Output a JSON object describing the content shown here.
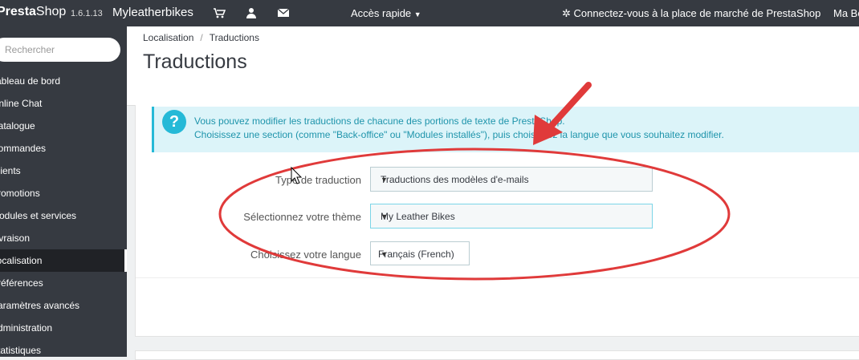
{
  "topbar": {
    "logo_presta": "Presta",
    "logo_shop": "Shop",
    "version": "1.6.1.13",
    "shop_name": "Myleatherbikes",
    "quick_access": "Accès rapide",
    "connect_text": "Connectez-vous à la place de marché de PrestaShop",
    "user_text": "Ma Bo"
  },
  "sidebar": {
    "search_placeholder": "Rechercher",
    "items": [
      {
        "label": "Tableau de bord"
      },
      {
        "label": "Online Chat"
      },
      {
        "label": "Catalogue"
      },
      {
        "label": "Commandes"
      },
      {
        "label": "Clients"
      },
      {
        "label": "Promotions"
      },
      {
        "label": "Modules et services"
      },
      {
        "label": "Livraison"
      },
      {
        "label": "Localisation",
        "active": true
      },
      {
        "label": "Préférences"
      },
      {
        "label": "Paramètres avancés"
      },
      {
        "label": "Administration"
      },
      {
        "label": "Statistiques"
      }
    ]
  },
  "breadcrumb": {
    "parent": "Localisation",
    "separator": "/",
    "current": "Traductions"
  },
  "page_title": "Traductions",
  "alert": {
    "line1": "Vous pouvez modifier les traductions de chacune des portions de texte de PrestaShop.",
    "line2": "Choisissez une section (comme \"Back-office\" ou \"Modules installés\"), puis choisissez la langue que vous souhaitez modifier."
  },
  "form": {
    "type_label": "Type de traduction",
    "type_value": "Traductions des modèles d'e-mails",
    "theme_label": "Sélectionnez votre thème",
    "theme_value": "My Leather Bikes",
    "language_label": "Choisissez votre langue",
    "language_value": "Français (French)"
  },
  "colors": {
    "topbar": "#363a41",
    "accent": "#25b9d7",
    "annotation": "#e03a3a"
  }
}
